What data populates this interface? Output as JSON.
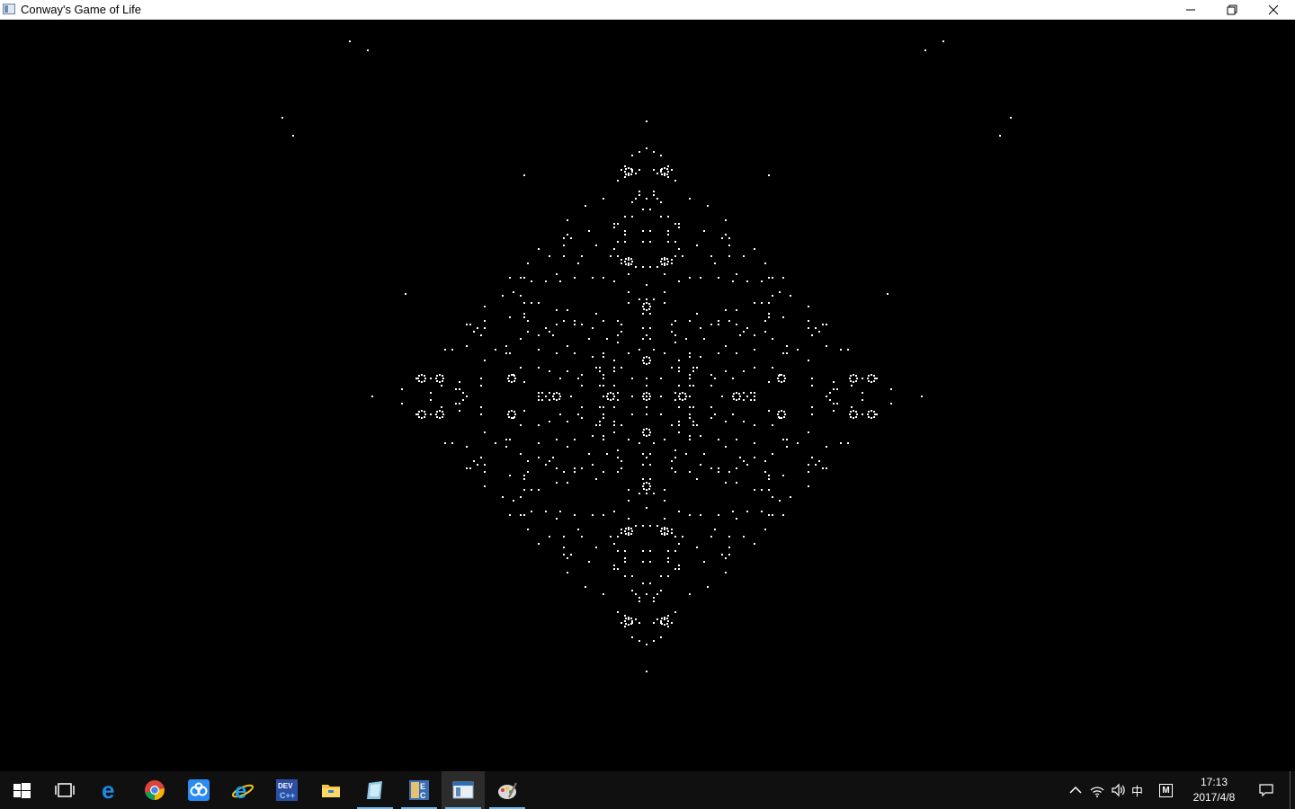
{
  "window": {
    "title": "Conway's Game of Life"
  },
  "taskbar": {
    "clock_time": "17:13",
    "clock_date": "2017/4/8",
    "ime_label": "中",
    "ime_mode": "M",
    "pinned": [
      "start-icon",
      "task-view-icon",
      "edge-icon",
      "chrome-icon",
      "baidu-netdisk-icon",
      "internet-explorer-icon",
      "dev-cpp-icon",
      "file-explorer-icon",
      "notepad-icon",
      "game-app-icon",
      "life-window-icon",
      "paint-icon"
    ]
  },
  "colors": {
    "cell": "#ffffff",
    "background": "#000000",
    "accent": "#76b9ed"
  }
}
